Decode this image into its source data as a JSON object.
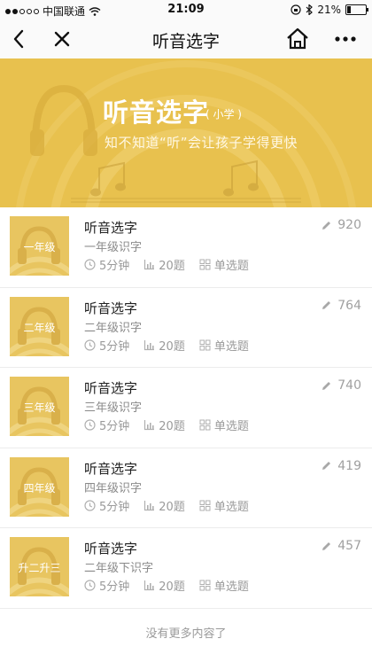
{
  "status_bar": {
    "carrier": "中国联通",
    "time": "21:09",
    "battery": "21%",
    "battery_level": 0.21
  },
  "nav": {
    "title": "听音选字"
  },
  "banner": {
    "title": "听音选字",
    "tag": "( 小学 )",
    "subtitle": "知不知道“听”会让孩子学得更快"
  },
  "items": [
    {
      "thumb_label": "一年级",
      "title": "听音选字",
      "subtitle": "一年级识字",
      "duration": "5分钟",
      "questions": "20题",
      "type": "单选题",
      "count": "920"
    },
    {
      "thumb_label": "二年级",
      "title": "听音选字",
      "subtitle": "二年级识字",
      "duration": "5分钟",
      "questions": "20题",
      "type": "单选题",
      "count": "764"
    },
    {
      "thumb_label": "三年级",
      "title": "听音选字",
      "subtitle": "三年级识字",
      "duration": "5分钟",
      "questions": "20题",
      "type": "单选题",
      "count": "740"
    },
    {
      "thumb_label": "四年级",
      "title": "听音选字",
      "subtitle": "四年级识字",
      "duration": "5分钟",
      "questions": "20题",
      "type": "单选题",
      "count": "419"
    },
    {
      "thumb_label": "升二升三",
      "title": "听音选字",
      "subtitle": "二年级下识字",
      "duration": "5分钟",
      "questions": "20题",
      "type": "单选题",
      "count": "457"
    }
  ],
  "footer": {
    "text": "没有更多内容了"
  },
  "colors": {
    "banner_bg": "#e8c14e",
    "thumb_bg": "#e8c560"
  },
  "icons": [
    "back-arrow-icon",
    "close-icon",
    "home-icon",
    "more-icon",
    "headphones-icon",
    "music-note-icon",
    "pencil-icon",
    "clock-icon",
    "bar-chart-icon",
    "grid-icon"
  ]
}
